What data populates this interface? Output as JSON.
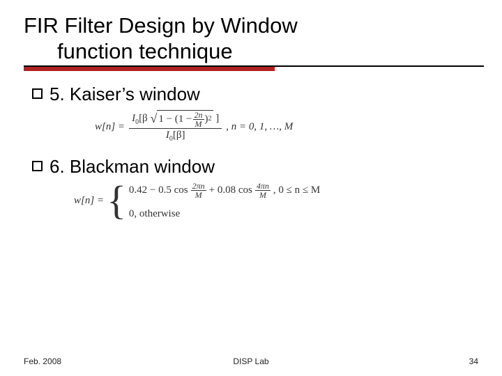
{
  "title_line1": "FIR Filter Design by Window",
  "title_line2": "function technique",
  "bullets": {
    "item5": "5. Kaiser’s window",
    "item6": "6. Blackman window"
  },
  "kaiser": {
    "lhs": "w[n] =",
    "num_prefix": "I",
    "num_sub": "0",
    "num_open": "[β",
    "sqrt_part1": "1 − (1 −",
    "sqrt_frac_num": "2n",
    "sqrt_frac_den": "M",
    "sqrt_close": ")",
    "sqrt_sup": "2",
    "num_close": "]",
    "den": "I",
    "den_sub": "0",
    "den_in": "[β]",
    "tail": ", n = 0, 1, …, M"
  },
  "blackman": {
    "lhs": "w[n] =",
    "case1_a": "0.42 − 0.5 cos",
    "case1_f1n": "2πn",
    "case1_f1d": "M",
    "case1_b": "+ 0.08 cos",
    "case1_f2n": "4πn",
    "case1_f2d": "M",
    "case1_tail": ",  0 ≤ n ≤ M",
    "case2": "0,   otherwise"
  },
  "footer": {
    "left": "Feb. 2008",
    "center": "DISP Lab",
    "right": "34"
  }
}
